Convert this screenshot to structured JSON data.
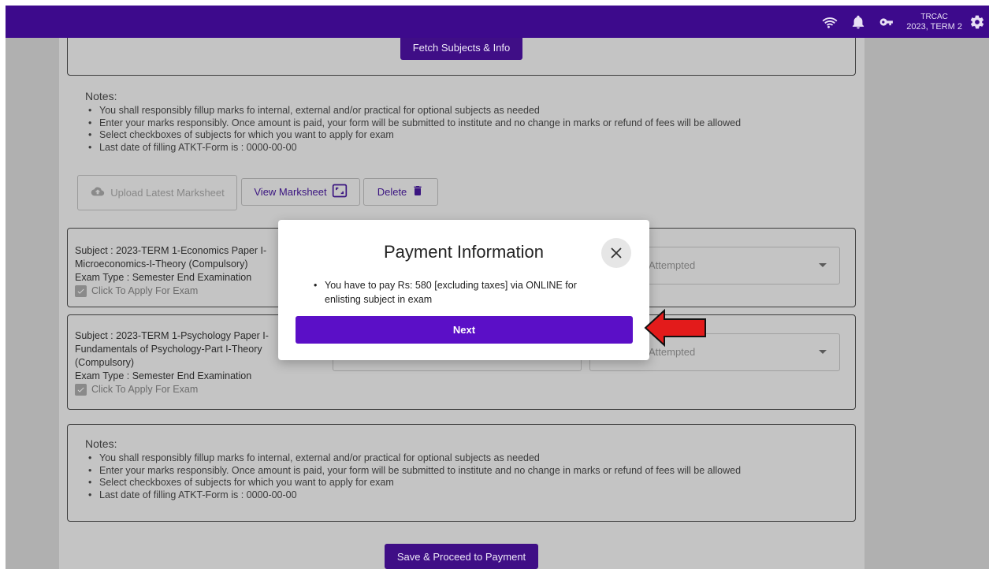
{
  "topbar": {
    "institute": "TRCAC",
    "term": "2023, TERM 2",
    "icons": [
      "wifi-icon",
      "bell-icon",
      "key-icon",
      "gear-icon"
    ]
  },
  "top_section": {
    "fetch_button": "Fetch Subjects & Info"
  },
  "notes_top": {
    "heading": "Notes:",
    "items": [
      "You shall responsibly fillup marks fo internal, external and/or practical for optional subjects as needed",
      "Enter your marks responsibly. Once amount is paid, your form will be submitted to institute and no change in marks or refund of fees will be allowed",
      "Select checkboxes of subjects for which you want to apply for exam",
      "Last date of filling ATKT-Form is : 0000-00-00"
    ]
  },
  "marksheet": {
    "upload_label": "Upload Latest Marksheet",
    "view_label": "View Marksheet",
    "delete_label": "Delete"
  },
  "subjects": [
    {
      "line1": "Subject : 2023-TERM 1-Economics Paper I-",
      "line2": "Microeconomics-I-Theory (Compulsory)",
      "exam_type": "Exam Type : Semester End Examination",
      "apply_label": "Click To Apply For Exam",
      "status": "Attempted"
    },
    {
      "line1": "Subject : 2023-TERM 1-Psychology Paper I-",
      "line2": "Fundamentals of Psychology-Part I-Theory",
      "line3": "(Compulsory)",
      "exam_type": "Exam Type : Semester End Examination",
      "apply_label": "Click To Apply For Exam",
      "status": "Attempted"
    }
  ],
  "notes_bottom": {
    "heading": "Notes:",
    "items": [
      "You shall responsibly fillup marks fo internal, external and/or practical for optional subjects as needed",
      "Enter your marks responsibly. Once amount is paid, your form will be submitted to institute and no change in marks or refund of fees will be allowed",
      "Select checkboxes of subjects for which you want to apply for exam",
      "Last date of filling ATKT-Form is : 0000-00-00"
    ]
  },
  "footer": {
    "save_button": "Save & Proceed to Payment"
  },
  "modal": {
    "title": "Payment Information",
    "message_line1": "You have to pay Rs: 580 [excluding taxes] via ONLINE for",
    "message_line2": "enlisting subject in exam",
    "next_button": "Next"
  },
  "colors": {
    "topbar": "#3d0a8c",
    "primary_button": "#3f0e86",
    "modal_button": "#5b0fc7",
    "arrow": "#e31b1b"
  }
}
